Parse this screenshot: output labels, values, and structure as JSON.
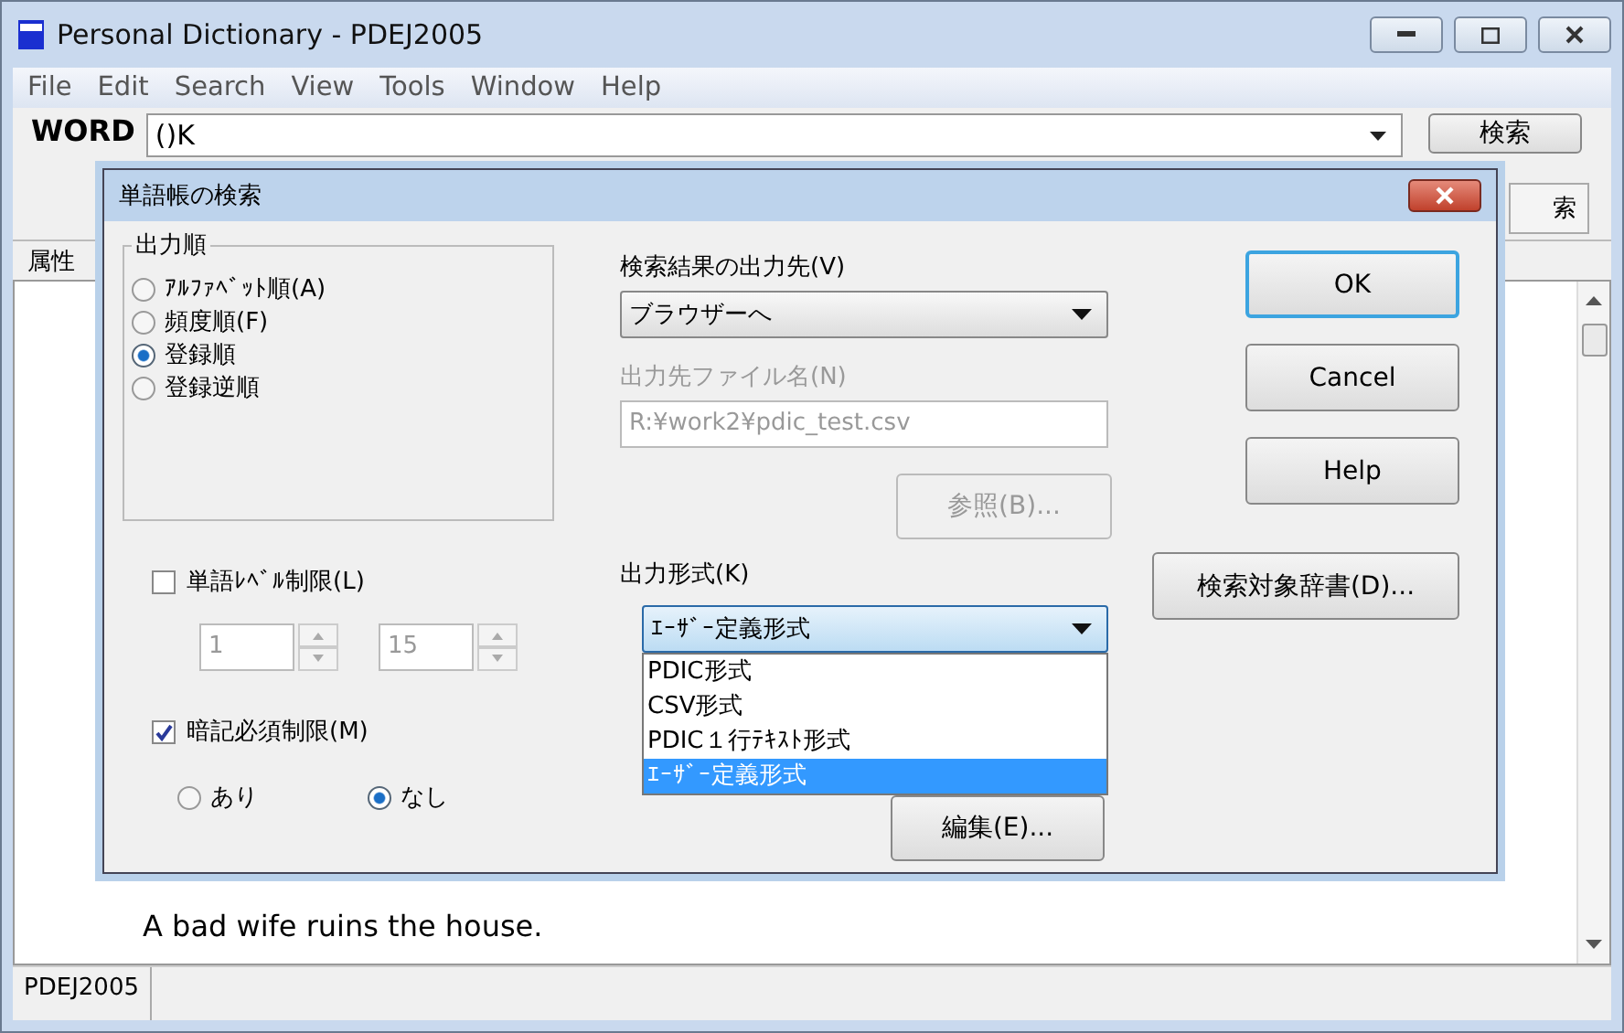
{
  "window": {
    "title": "Personal Dictionary - PDEJ2005"
  },
  "menu": [
    "File",
    "Edit",
    "Search",
    "View",
    "Tools",
    "Window",
    "Help"
  ],
  "word_bar": {
    "label": "WORD",
    "value": "()K",
    "button": "検索"
  },
  "toolbar": {
    "button": "索"
  },
  "column_header": "属性",
  "entries": [
    "A bad wife ruins the house."
  ],
  "status_bar": "PDEJ2005",
  "dialog": {
    "title": "単語帳の検索",
    "order": {
      "label": "出力順",
      "options": [
        {
          "label": "ｱﾙﾌｧﾍﾞｯﾄ順(A)",
          "selected": false
        },
        {
          "label": "頻度順(F)",
          "selected": false
        },
        {
          "label": "登録順",
          "selected": true
        },
        {
          "label": "登録逆順",
          "selected": false
        }
      ]
    },
    "level_limit": {
      "label": "単語ﾚﾍﾞﾙ制限(L)",
      "checked": false,
      "from": "1",
      "to": "15",
      "disabled": true
    },
    "memorize_limit": {
      "label": "暗記必須制限(M)",
      "checked": true,
      "options": [
        {
          "label": "あり",
          "selected": false
        },
        {
          "label": "なし",
          "selected": true
        }
      ]
    },
    "destination": {
      "label": "検索結果の出力先(V)",
      "value": "ブラウザーへ"
    },
    "filename": {
      "label": "出力先ファイル名(N)",
      "value": "R:¥work2¥pdic_test.csv",
      "disabled": true
    },
    "browse_button": {
      "label": "参照(B)...",
      "disabled": true
    },
    "format": {
      "label": "出力形式(K)",
      "value": "ｴｰｻﾞｰ定義形式",
      "expanded": true,
      "options": [
        {
          "label": "PDIC形式",
          "selected": false
        },
        {
          "label": "CSV形式",
          "selected": false
        },
        {
          "label": "PDIC１行ﾃｷｽﾄ形式",
          "selected": false
        },
        {
          "label": "ｴｰｻﾞｰ定義形式",
          "selected": true
        }
      ]
    },
    "edit_button": "編集(E)...",
    "buttons": [
      {
        "label": "OK",
        "default": true
      },
      {
        "label": "Cancel",
        "default": false
      },
      {
        "label": "Help",
        "default": false
      }
    ],
    "dictionary_button": "検索対象辞書(D)..."
  }
}
